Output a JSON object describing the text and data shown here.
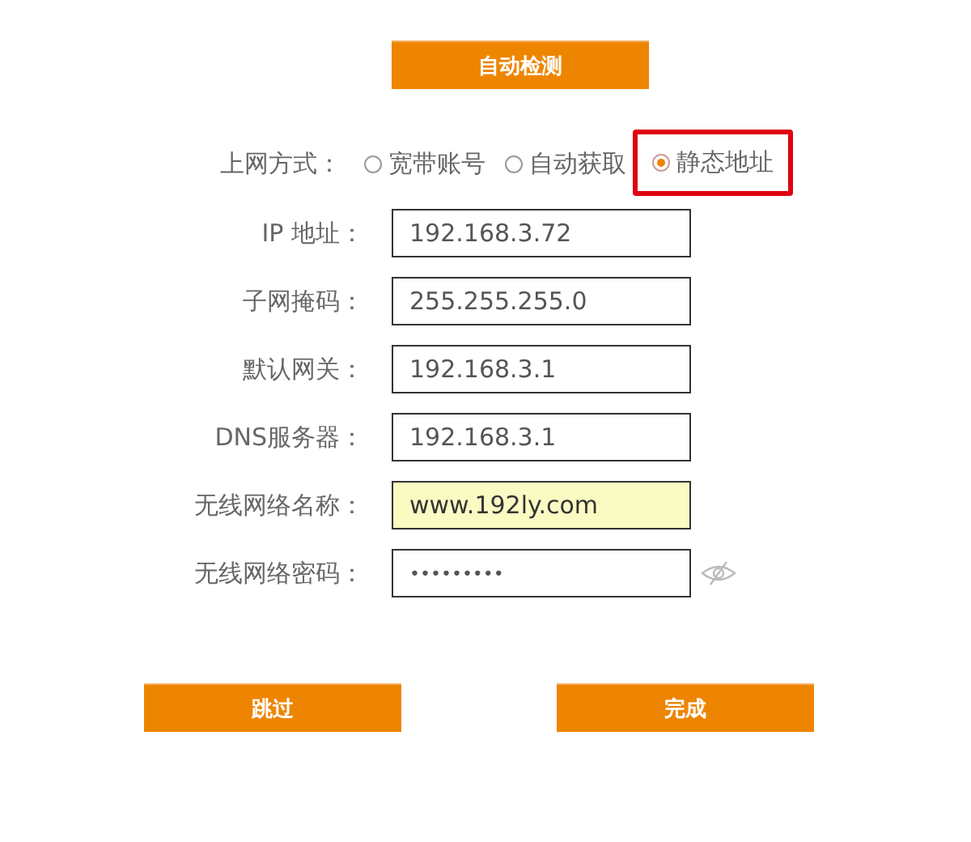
{
  "detect_button": "自动检测",
  "connection_type": {
    "label": "上网方式：",
    "options": [
      {
        "label": "宽带账号",
        "selected": false,
        "highlighted": false
      },
      {
        "label": "自动获取",
        "selected": false,
        "highlighted": false
      },
      {
        "label": "静态地址",
        "selected": true,
        "highlighted": true
      }
    ]
  },
  "fields": [
    {
      "label": "IP 地址：",
      "value": "192.168.3.72",
      "autofilled": false,
      "kind": "text"
    },
    {
      "label": "子网掩码：",
      "value": "255.255.255.0",
      "autofilled": false,
      "kind": "text"
    },
    {
      "label": "默认网关：",
      "value": "192.168.3.1",
      "autofilled": false,
      "kind": "text"
    },
    {
      "label": "DNS服务器：",
      "value": "192.168.3.1",
      "autofilled": false,
      "kind": "text"
    },
    {
      "label": "无线网络名称：",
      "value": "www.192ly.com",
      "autofilled": true,
      "kind": "text"
    },
    {
      "label": "无线网络密码：",
      "value": "•••••••••",
      "autofilled": false,
      "kind": "password"
    }
  ],
  "buttons": [
    "跳过",
    "完成"
  ]
}
